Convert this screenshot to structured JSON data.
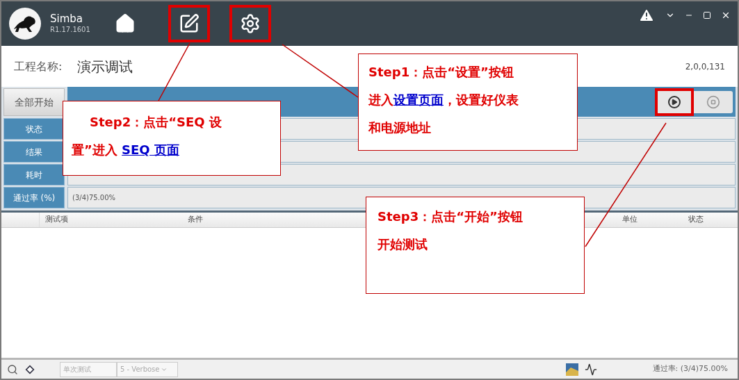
{
  "title_bar": {
    "app_name": "Simba",
    "version": "R1.17.1601"
  },
  "nav": [
    {
      "kind": "home",
      "highlighted": false
    },
    {
      "kind": "edit",
      "highlighted": true
    },
    {
      "kind": "settings",
      "highlighted": true
    }
  ],
  "project": {
    "label": "工程名称:",
    "name": "演示调试",
    "version": "2,0,0,131"
  },
  "start_all_button": "全部开始",
  "run_controls": [
    {
      "kind": "play",
      "highlighted": true
    },
    {
      "kind": "stop",
      "highlighted": false
    }
  ],
  "info_rows": [
    {
      "label": "状态"
    },
    {
      "label": "结果"
    },
    {
      "label": "耗时"
    },
    {
      "label": "通过率 (%)",
      "value": "(3/4)75.00%"
    }
  ],
  "table": {
    "columns": [
      "测试项",
      "条件",
      "单位",
      "状态"
    ]
  },
  "status_bar": {
    "mode_field": "单次测试",
    "log_level": "5 - Verbose",
    "pass_rate": "通过率: (3/4)75.00%"
  },
  "callouts": [
    {
      "lines": [
        [
          {
            "kind": "plain",
            "text": "Step1：点击“设置”按钮"
          }
        ],
        [
          {
            "kind": "plain",
            "text": "进入"
          },
          {
            "kind": "link",
            "text": "设置页面"
          },
          {
            "kind": "plain",
            "text": "，设置好仪表"
          }
        ],
        [
          {
            "kind": "plain",
            "text": "和电源地址"
          }
        ]
      ]
    },
    {
      "lines": [
        [
          {
            "kind": "plain",
            "text": "Step2：点击“SEQ 设"
          }
        ],
        [
          {
            "kind": "plain",
            "text": "置”进入 "
          },
          {
            "kind": "link",
            "text": "SEQ 页面"
          }
        ]
      ]
    },
    {
      "lines": [
        [
          {
            "kind": "plain",
            "text": "Step3：点击“开始”按钮"
          }
        ],
        [
          {
            "kind": "plain",
            "text": "开始测试"
          }
        ]
      ]
    }
  ]
}
